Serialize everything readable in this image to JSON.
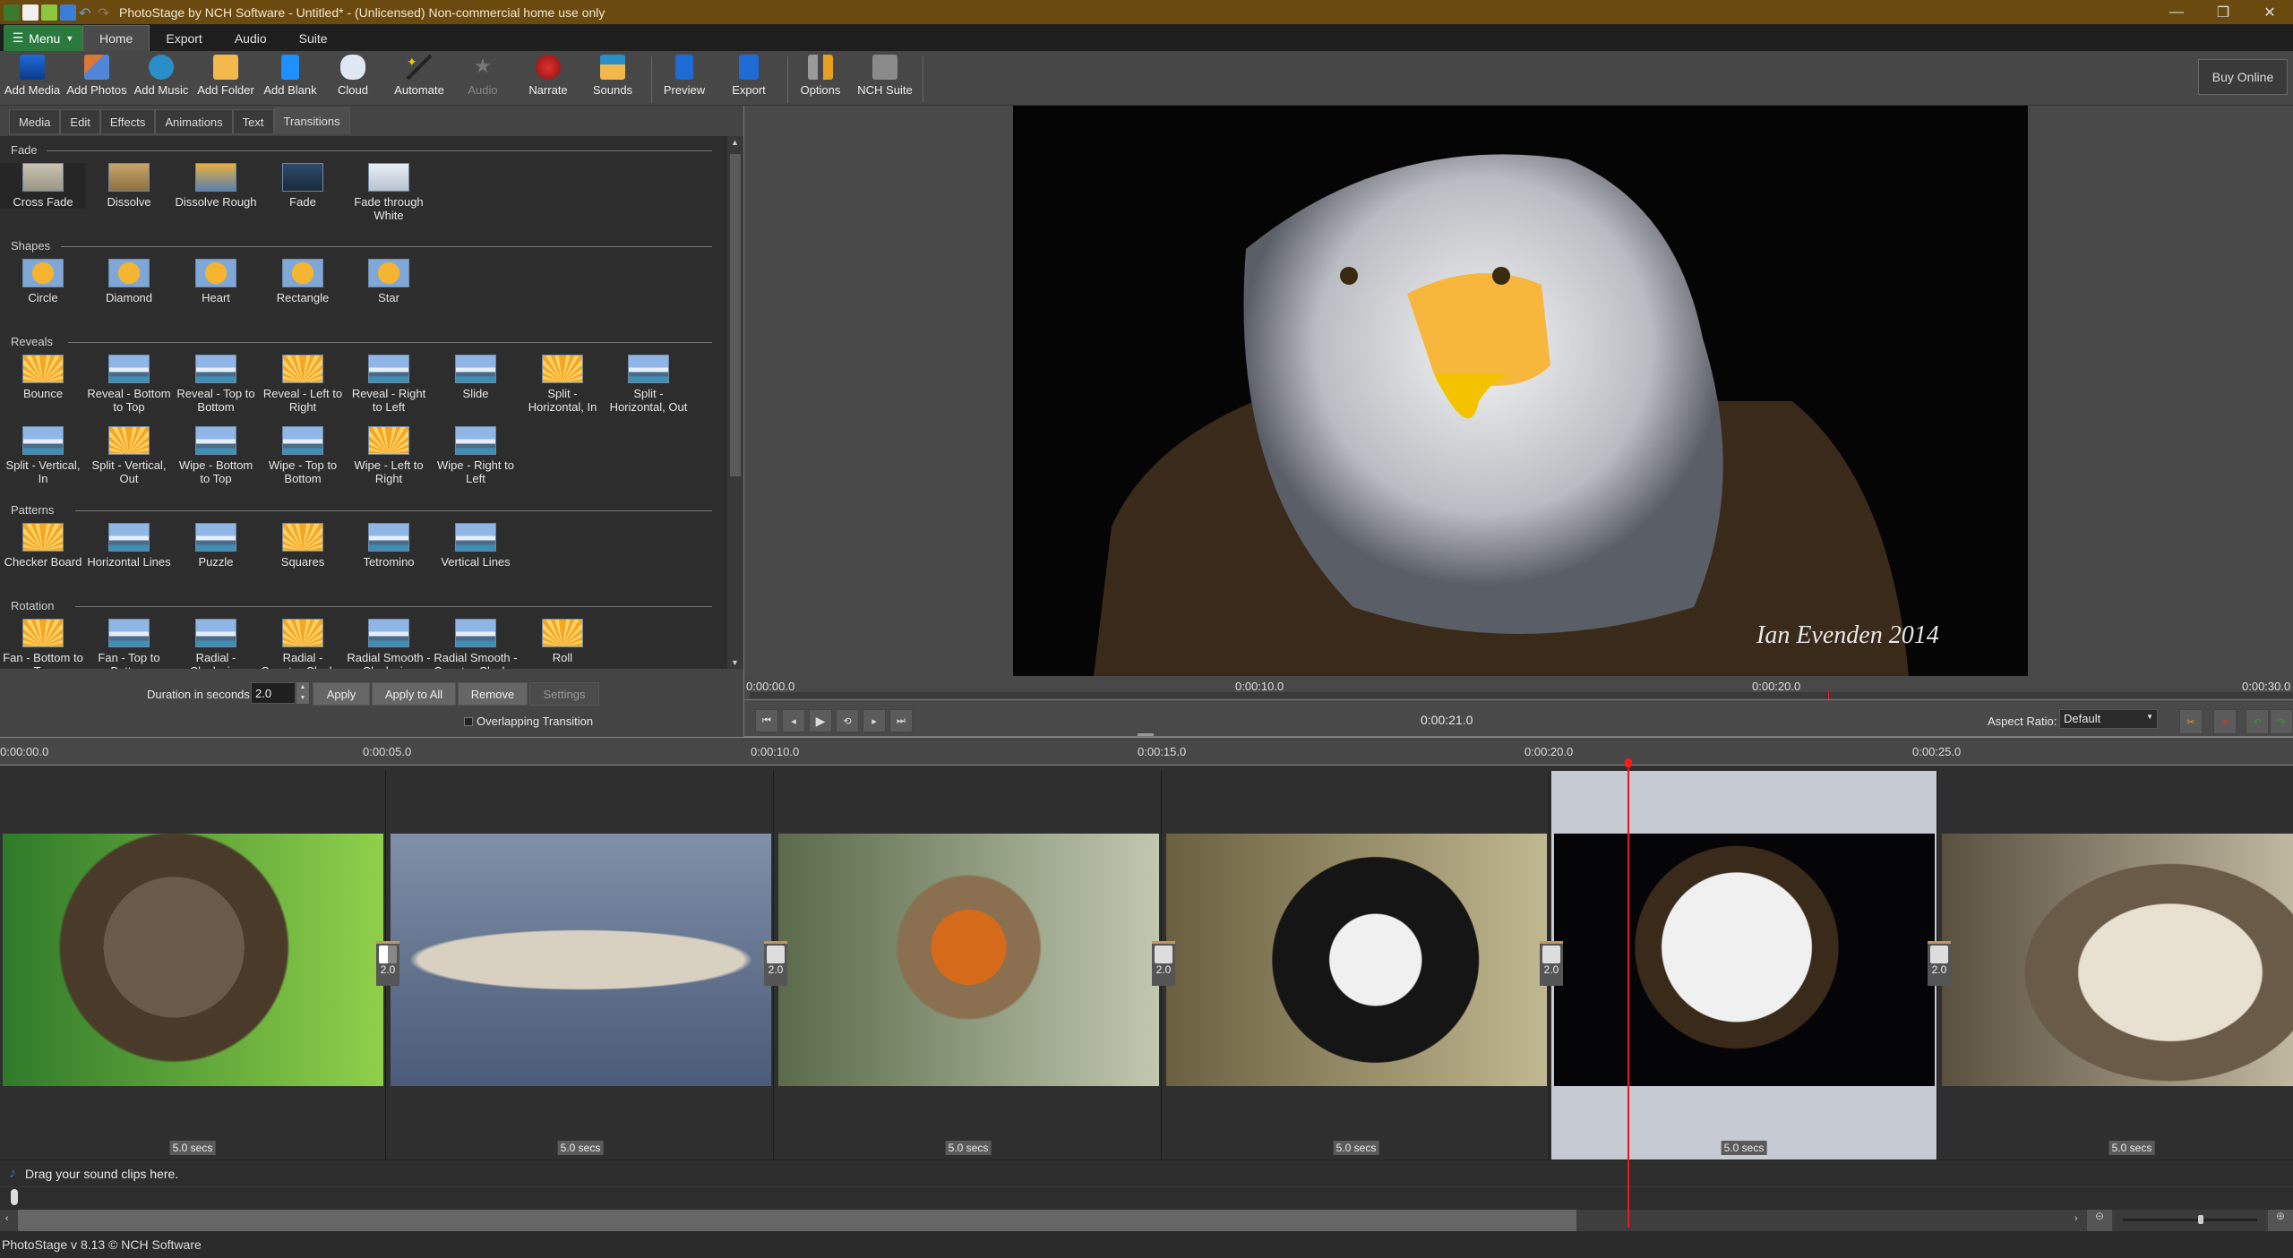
{
  "titlebar": {
    "title": "PhotoStage by NCH Software - Untitled* - (Unlicensed) Non-commercial home use only",
    "quick_access": [
      "app-icon",
      "new-icon",
      "open-icon",
      "save-icon",
      "undo-icon",
      "redo-icon"
    ],
    "window_controls": {
      "minimize": "—",
      "restore": "❐",
      "close": "✕"
    }
  },
  "menubar": {
    "menu_label": "Menu",
    "tabs": [
      "Home",
      "Export",
      "Audio",
      "Suite"
    ],
    "active_tab": "Home",
    "social_icons": [
      "flickr-icon",
      "youtube-icon",
      "like-icon",
      "facebook-icon",
      "twitter-icon",
      "linkedin-icon",
      "help-icon"
    ]
  },
  "ribbon": {
    "buttons": [
      {
        "label": "Add Media",
        "icon": "add-media-icon",
        "enabled": true
      },
      {
        "label": "Add Photos",
        "icon": "add-photos-icon",
        "enabled": true
      },
      {
        "label": "Add Music",
        "icon": "add-music-icon",
        "enabled": true
      },
      {
        "label": "Add Folder",
        "icon": "add-folder-icon",
        "enabled": true
      },
      {
        "label": "Add Blank",
        "icon": "add-blank-icon",
        "enabled": true
      },
      {
        "label": "Cloud",
        "icon": "cloud-icon",
        "enabled": true
      },
      {
        "label": "Automate",
        "icon": "automate-wand-icon",
        "enabled": true
      },
      {
        "label": "Audio",
        "icon": "audio-icon",
        "enabled": false
      },
      {
        "label": "Narrate",
        "icon": "narrate-record-icon",
        "enabled": true
      },
      {
        "label": "Sounds",
        "icon": "sounds-icon",
        "enabled": true
      },
      {
        "label": "Preview",
        "icon": "preview-icon",
        "enabled": true
      },
      {
        "label": "Export",
        "icon": "export-icon",
        "enabled": true
      },
      {
        "label": "Options",
        "icon": "options-tools-icon",
        "enabled": true
      },
      {
        "label": "NCH Suite",
        "icon": "nch-suite-icon",
        "enabled": true
      }
    ],
    "buy_online": "Buy Online"
  },
  "panel": {
    "tabs": [
      "Media",
      "Edit",
      "Effects",
      "Animations",
      "Text",
      "Transitions"
    ],
    "active_tab": "Transitions",
    "categories": [
      {
        "name": "Fade",
        "items": [
          "Cross Fade",
          "Dissolve",
          "Dissolve Rough",
          "Fade",
          "Fade through White"
        ]
      },
      {
        "name": "Shapes",
        "items": [
          "Circle",
          "Diamond",
          "Heart",
          "Rectangle",
          "Star"
        ]
      },
      {
        "name": "Reveals",
        "items": [
          "Bounce",
          "Reveal - Bottom to Top",
          "Reveal - Top to Bottom",
          "Reveal - Left to Right",
          "Reveal - Right to Left",
          "Slide",
          "Split - Horizontal, In",
          "Split - Horizontal, Out",
          "Split - Vertical, In",
          "Split - Vertical, Out",
          "Wipe - Bottom to Top",
          "Wipe - Top to Bottom",
          "Wipe - Left to Right",
          "Wipe - Right to Left"
        ]
      },
      {
        "name": "Patterns",
        "items": [
          "Checker Board",
          "Horizontal Lines",
          "Puzzle",
          "Squares",
          "Tetromino",
          "Vertical Lines"
        ]
      },
      {
        "name": "Rotation",
        "items": [
          "Fan - Bottom to Top",
          "Fan - Top to Bottom",
          "Radial - Clockwise",
          "Radial - Counter-Clock...",
          "Radial Smooth - Clockwise",
          "Radial Smooth - Counter-Clock...",
          "Roll"
        ]
      }
    ],
    "selected_item": "Cross Fade",
    "duration_label": "Duration in seconds:",
    "duration_value": "2.0",
    "apply": "Apply",
    "apply_all": "Apply to All",
    "remove": "Remove",
    "settings": "Settings",
    "overlapping": "Overlapping Transition",
    "overlapping_checked": false
  },
  "preview": {
    "watermark": "Ian Evenden 2014",
    "ruler_ticks": [
      "0:00:00.0",
      "0:00:10.0",
      "0:00:20.0",
      "0:00:30.0"
    ],
    "current_time": "0:00:21.0",
    "aspect_label": "Aspect Ratio:",
    "aspect_value": "Default",
    "transport": [
      "go-start-icon",
      "step-back-icon",
      "play-icon",
      "loop-icon",
      "step-forward-icon",
      "go-end-icon"
    ],
    "tools": [
      "cut-icon",
      "delete-icon",
      "undo-rotate-icon",
      "redo-rotate-icon"
    ]
  },
  "timeline": {
    "ruler_ticks": [
      "0:00:00.0",
      "0:00:05.0",
      "0:00:10.0",
      "0:00:15.0",
      "0:00:20.0",
      "0:00:25.0"
    ],
    "clips": [
      {
        "subject": "vulture",
        "duration": "5.0 secs",
        "selected": false
      },
      {
        "subject": "snowy owl",
        "duration": "5.0 secs",
        "selected": false
      },
      {
        "subject": "robin",
        "duration": "5.0 secs",
        "selected": false
      },
      {
        "subject": "puffin",
        "duration": "5.0 secs",
        "selected": false
      },
      {
        "subject": "bald eagle",
        "duration": "5.0 secs",
        "selected": true
      },
      {
        "subject": "griffon vulture",
        "duration": "5.0 secs",
        "selected": false
      }
    ],
    "transitions": [
      {
        "type": "wipe",
        "value": "2.0"
      },
      {
        "type": "cross-fade",
        "value": "2.0"
      },
      {
        "type": "cross-fade",
        "value": "2.0"
      },
      {
        "type": "cross-fade",
        "value": "2.0"
      },
      {
        "type": "cross-fade",
        "value": "2.0"
      }
    ],
    "playhead_time": "0:00:21.0",
    "sound_hint": "Drag your sound clips here."
  },
  "status": {
    "text": "PhotoStage v 8.13 © NCH Software"
  }
}
